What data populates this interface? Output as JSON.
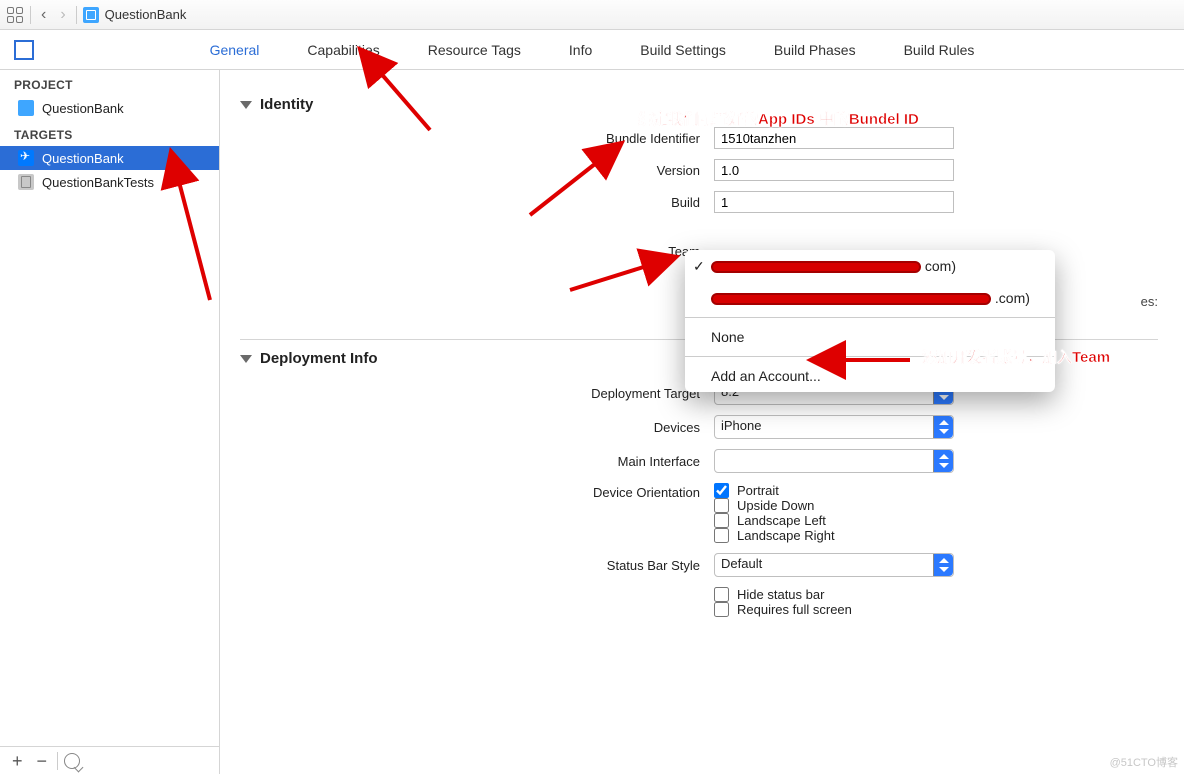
{
  "breadcrumb": {
    "title": "QuestionBank"
  },
  "tabs": {
    "general": "General",
    "capabilities": "Capabilities",
    "resource_tags": "Resource Tags",
    "info": "Info",
    "build_settings": "Build Settings",
    "build_phases": "Build Phases",
    "build_rules": "Build Rules",
    "active": "general"
  },
  "sidebar": {
    "headers": {
      "project": "PROJECT",
      "targets": "TARGETS"
    },
    "project": "QuestionBank",
    "targets": [
      "QuestionBank",
      "QuestionBankTests"
    ],
    "selected_target": 0
  },
  "sections": {
    "identity": "Identity",
    "deployment": "Deployment Info"
  },
  "identity": {
    "labels": {
      "bundle": "Bundle Identifier",
      "version": "Version",
      "build": "Build",
      "team": "Team"
    },
    "bundle": "1510tanzhen",
    "version": "1.0",
    "build": "1",
    "warning_extra": "es:"
  },
  "team_popup": {
    "suffix1": "com)",
    "suffix2": ".com)",
    "none": "None",
    "add": "Add an Account..."
  },
  "deployment": {
    "labels": {
      "target": "Deployment Target",
      "devices": "Devices",
      "main_interface": "Main Interface",
      "orientation": "Device Orientation",
      "status_style": "Status Bar Style"
    },
    "target": "8.2",
    "devices": "iPhone",
    "main_interface": "",
    "orientation": {
      "portrait": "Portrait",
      "upside": "Upside Down",
      "left": "Landscape Left",
      "right": "Landscape Right",
      "checked": [
        "portrait"
      ]
    },
    "status_style": "Default",
    "hide_status": "Hide status bar",
    "requires_fs": "Requires full screen"
  },
  "annotations": {
    "bundle_note": "绑定我们配置好的App IDs 中的Bundel ID",
    "team_note": "添加开发者账号，加入Team"
  },
  "watermark": "@51CTO博客"
}
